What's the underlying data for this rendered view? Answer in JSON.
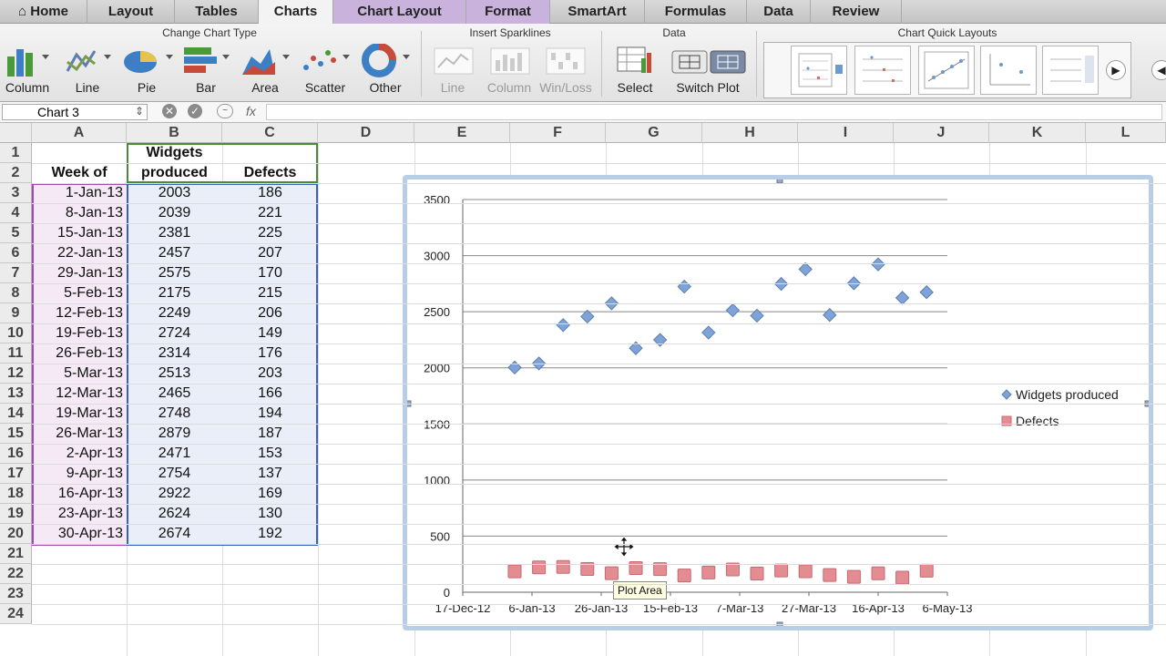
{
  "tabs": [
    "Home",
    "Layout",
    "Tables",
    "Charts",
    "Chart Layout",
    "Format",
    "SmartArt",
    "Formulas",
    "Data",
    "Review"
  ],
  "ribbon": {
    "group_change_chart_type": "Change Chart Type",
    "group_sparklines": "Insert Sparklines",
    "group_data": "Data",
    "group_quick_layouts": "Chart Quick Layouts",
    "chart_types": [
      "Column",
      "Line",
      "Pie",
      "Bar",
      "Area",
      "Scatter",
      "Other"
    ],
    "sparklines": [
      "Line",
      "Column",
      "Win/Loss"
    ],
    "data_buttons": [
      "Select",
      "Switch Plot"
    ]
  },
  "formula_bar": {
    "name_box": "Chart 3",
    "fx": "fx"
  },
  "columns": [
    "A",
    "B",
    "C",
    "D",
    "E",
    "F",
    "G",
    "H",
    "I",
    "J",
    "K",
    "L"
  ],
  "rows": [
    "1",
    "2",
    "3",
    "4",
    "5",
    "6",
    "7",
    "8",
    "9",
    "10",
    "11",
    "12",
    "13",
    "14",
    "15",
    "16",
    "17",
    "18",
    "19",
    "20",
    "21",
    "22",
    "23",
    "24"
  ],
  "headers": {
    "a": "Week of",
    "b1": "Widgets",
    "b2": "produced",
    "c": "Defects"
  },
  "table": [
    [
      "1-Jan-13",
      "2003",
      "186"
    ],
    [
      "8-Jan-13",
      "2039",
      "221"
    ],
    [
      "15-Jan-13",
      "2381",
      "225"
    ],
    [
      "22-Jan-13",
      "2457",
      "207"
    ],
    [
      "29-Jan-13",
      "2575",
      "170"
    ],
    [
      "5-Feb-13",
      "2175",
      "215"
    ],
    [
      "12-Feb-13",
      "2249",
      "206"
    ],
    [
      "19-Feb-13",
      "2724",
      "149"
    ],
    [
      "26-Feb-13",
      "2314",
      "176"
    ],
    [
      "5-Mar-13",
      "2513",
      "203"
    ],
    [
      "12-Mar-13",
      "2465",
      "166"
    ],
    [
      "19-Mar-13",
      "2748",
      "194"
    ],
    [
      "26-Mar-13",
      "2879",
      "187"
    ],
    [
      "2-Apr-13",
      "2471",
      "153"
    ],
    [
      "9-Apr-13",
      "2754",
      "137"
    ],
    [
      "16-Apr-13",
      "2922",
      "169"
    ],
    [
      "23-Apr-13",
      "2624",
      "130"
    ],
    [
      "30-Apr-13",
      "2674",
      "192"
    ]
  ],
  "tooltip": "Plot Area",
  "chart_data": {
    "type": "scatter",
    "x": [
      "2013-01-01",
      "2013-01-08",
      "2013-01-15",
      "2013-01-22",
      "2013-01-29",
      "2013-02-05",
      "2013-02-12",
      "2013-02-19",
      "2013-02-26",
      "2013-03-05",
      "2013-03-12",
      "2013-03-19",
      "2013-03-26",
      "2013-04-02",
      "2013-04-09",
      "2013-04-16",
      "2013-04-23",
      "2013-04-30"
    ],
    "series": [
      {
        "name": "Widgets produced",
        "color": "#7fa3d6",
        "marker": "diamond",
        "values": [
          2003,
          2039,
          2381,
          2457,
          2575,
          2175,
          2249,
          2724,
          2314,
          2513,
          2465,
          2748,
          2879,
          2471,
          2754,
          2922,
          2624,
          2674
        ]
      },
      {
        "name": "Defects",
        "color": "#e38d92",
        "marker": "square",
        "values": [
          186,
          221,
          225,
          207,
          170,
          215,
          206,
          149,
          176,
          203,
          166,
          194,
          187,
          153,
          137,
          169,
          130,
          192
        ]
      }
    ],
    "yticks": [
      "0",
      "500",
      "1000",
      "1500",
      "2000",
      "2500",
      "3000",
      "3500"
    ],
    "ylim": [
      0,
      3500
    ],
    "xticks": [
      "17-Dec-12",
      "6-Jan-13",
      "26-Jan-13",
      "15-Feb-13",
      "7-Mar-13",
      "27-Mar-13",
      "16-Apr-13",
      "6-May-13"
    ],
    "xlim": [
      "2012-12-17",
      "2013-05-06"
    ],
    "grid": true,
    "legend": "right"
  }
}
